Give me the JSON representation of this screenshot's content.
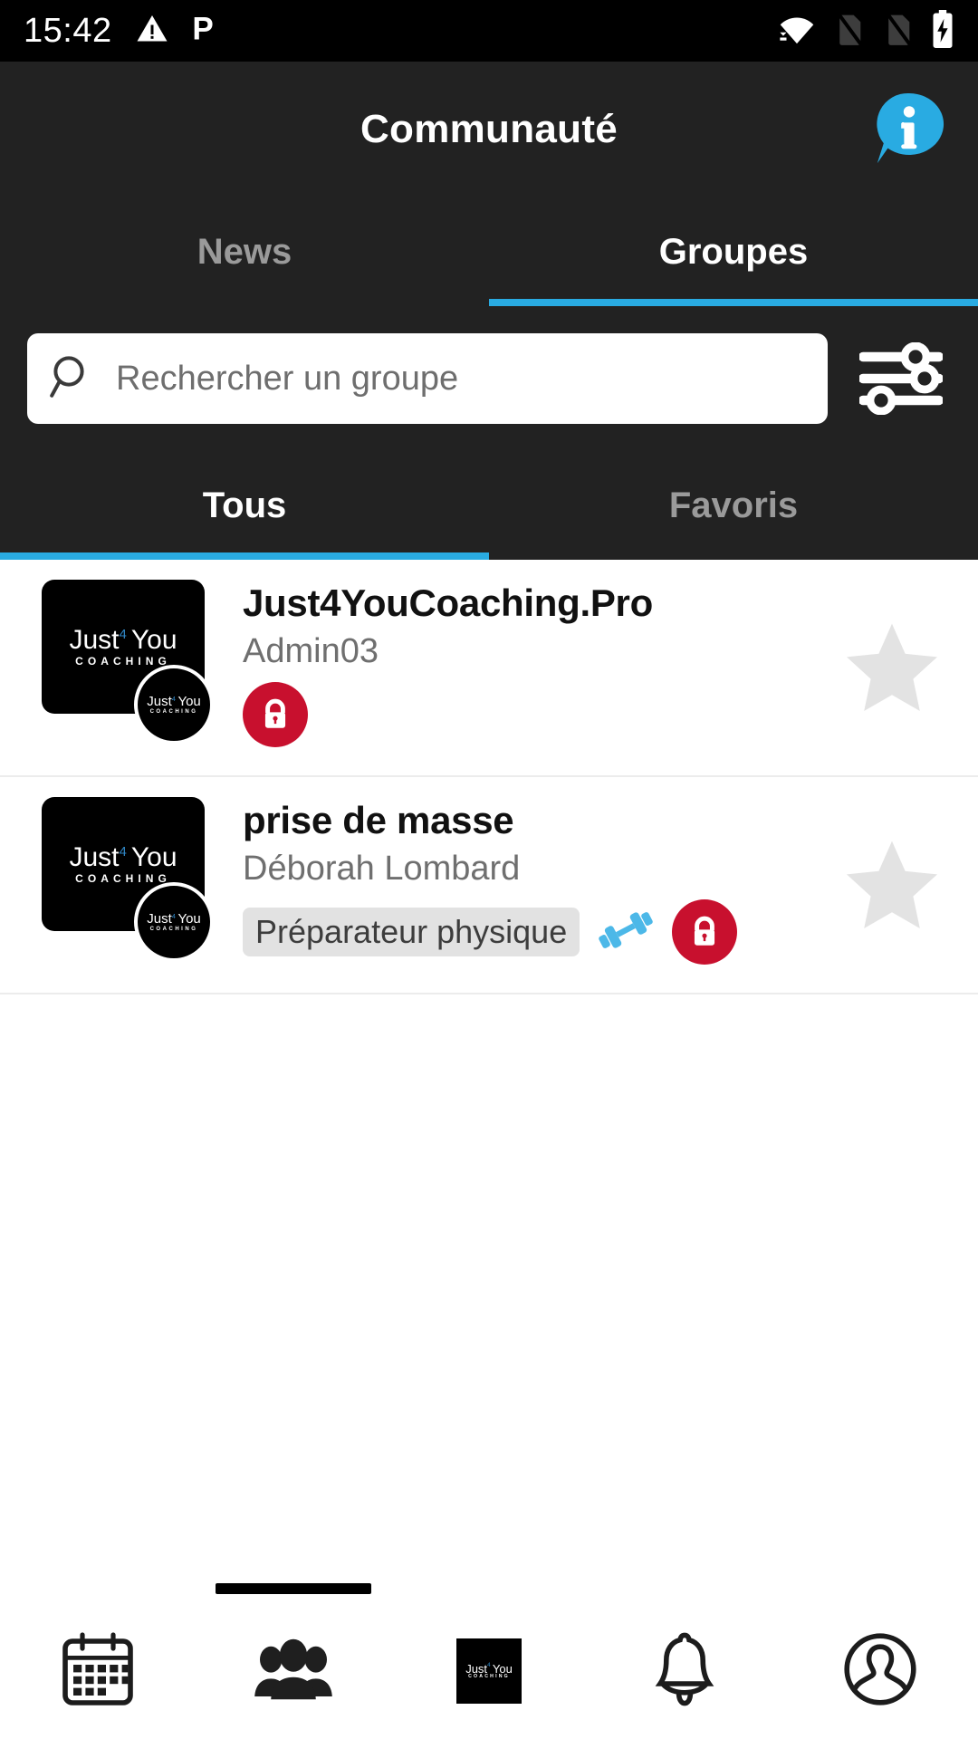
{
  "status_bar": {
    "time": "15:42",
    "icons": [
      "warning-triangle-icon",
      "parking-p-icon",
      "wifi-icon",
      "no-sim-1-icon",
      "no-sim-2-icon",
      "battery-charging-icon"
    ]
  },
  "header": {
    "title": "Communauté",
    "info_button": "info-bubble-icon"
  },
  "top_tabs": [
    {
      "label": "News",
      "active": false
    },
    {
      "label": "Groupes",
      "active": true
    }
  ],
  "search": {
    "placeholder": "Rechercher un groupe",
    "value": "",
    "search_icon": "search-icon",
    "filter_icon": "filter-sliders-icon"
  },
  "sub_tabs": [
    {
      "label": "Tous",
      "active": true
    },
    {
      "label": "Favoris",
      "active": false
    }
  ],
  "logo": {
    "word1": "Just",
    "sup": "4",
    "word2": "You",
    "tagline": "COACHING"
  },
  "groups": [
    {
      "title": "Just4YouCoaching.Pro",
      "owner": "Admin03",
      "chip": "",
      "has_dumbbell": false,
      "locked": true,
      "favorite": false
    },
    {
      "title": "prise de masse",
      "owner": "Déborah Lombard",
      "chip": "Préparateur physique",
      "has_dumbbell": true,
      "locked": true,
      "favorite": false
    }
  ],
  "bottom_nav": [
    {
      "name": "calendar",
      "icon": "calendar-icon",
      "active": false
    },
    {
      "name": "community",
      "icon": "people-group-icon",
      "active": true
    },
    {
      "name": "brand",
      "icon": "brand-logo-icon",
      "active": false
    },
    {
      "name": "notifications",
      "icon": "bell-icon",
      "active": false
    },
    {
      "name": "profile",
      "icon": "profile-avatar-icon",
      "active": false
    }
  ],
  "colors": {
    "accent": "#29abe2",
    "header_bg": "#222222",
    "lock_red": "#c8102e",
    "star_gray": "#e3e3e3",
    "chip_bg": "#e2e2e2"
  }
}
